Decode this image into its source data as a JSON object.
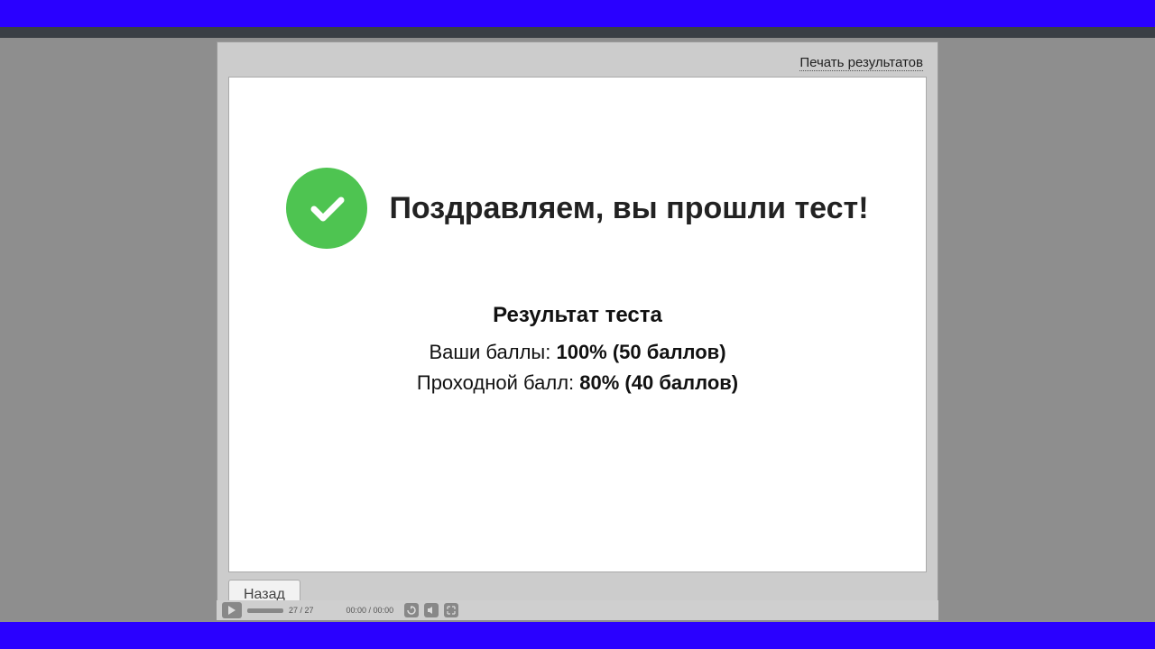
{
  "header": {
    "print_link_label": "Печать результатов"
  },
  "result": {
    "congrats_title": "Поздравляем, вы прошли тест!",
    "section_title": "Результат теста",
    "your_score_label": "Ваши баллы:",
    "your_score_value": "100% (50 баллов)",
    "passing_label": "Проходной балл:",
    "passing_value": "80% (40 баллов)"
  },
  "footer": {
    "back_label": "Назад"
  },
  "player": {
    "slide_counter": "27 / 27",
    "time": "00:00 / 00:00"
  }
}
